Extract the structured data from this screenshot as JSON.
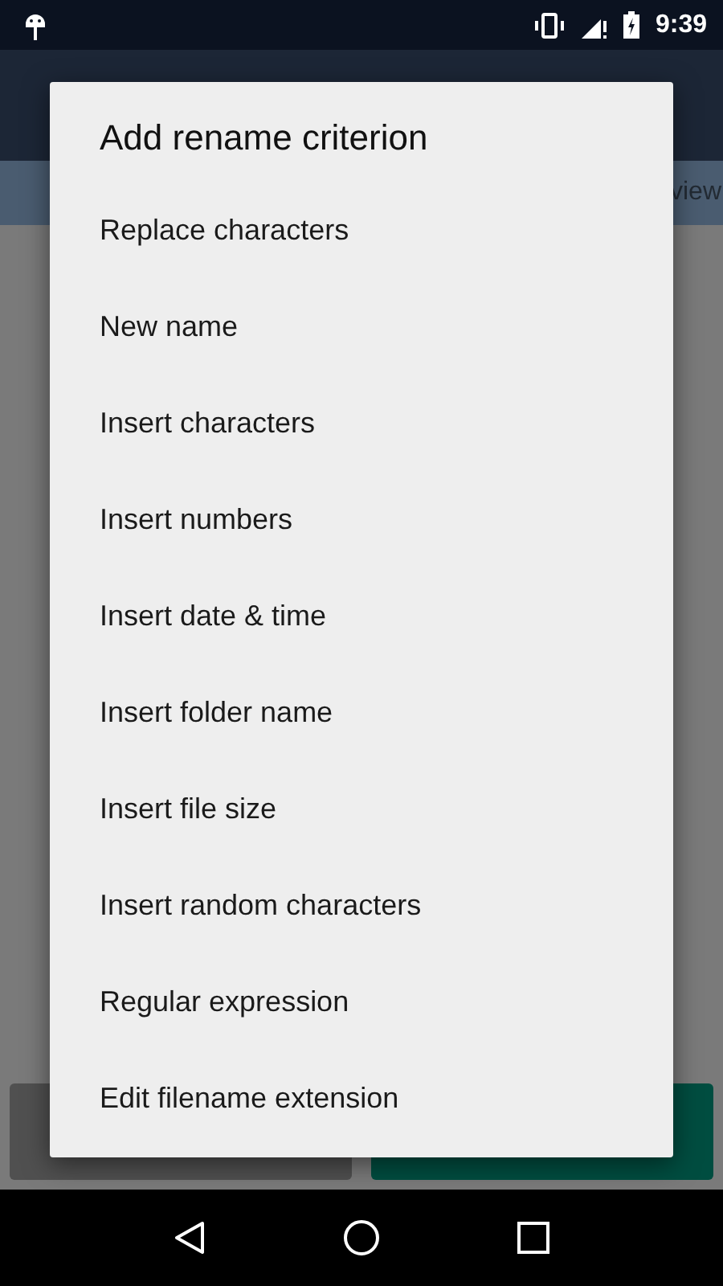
{
  "status_bar": {
    "time": "9:39"
  },
  "tab_bar": {
    "tab_partial": "view"
  },
  "dialog": {
    "title": "Add rename criterion",
    "items": [
      "Replace characters",
      "New name",
      "Insert characters",
      "Insert numbers",
      "Insert date & time",
      "Insert folder name",
      "Insert file size",
      "Insert random characters",
      "Regular expression",
      "Edit filename extension"
    ]
  }
}
